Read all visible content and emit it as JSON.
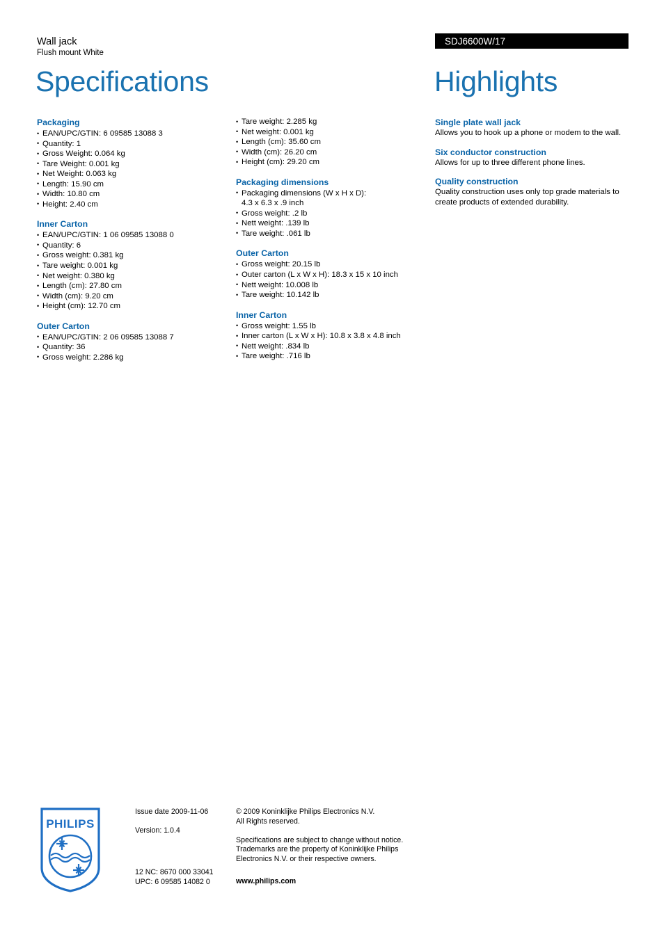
{
  "header": {
    "product_name": "Wall jack",
    "product_subtitle": "Flush mount White",
    "left_title": "Specifications",
    "right_title": "Highlights",
    "product_code": "SDJ6600W/17",
    "accent_color": "#0a64a8",
    "title_color": "#1a72b0",
    "code_bar_bg": "#000000"
  },
  "columns": {
    "col1": [
      {
        "heading": "Packaging",
        "items": [
          "EAN/UPC/GTIN: 6 09585 13088 3",
          "Quantity: 1",
          "Gross Weight: 0.064 kg",
          "Tare Weight: 0.001 kg",
          "Net Weight: 0.063 kg",
          "Length: 15.90 cm",
          "Width: 10.80 cm",
          "Height: 2.40 cm"
        ]
      },
      {
        "heading": "Inner Carton",
        "items": [
          "EAN/UPC/GTIN: 1 06 09585 13088 0",
          "Quantity: 6",
          "Gross weight: 0.381 kg",
          "Tare weight: 0.001 kg",
          "Net weight: 0.380 kg",
          "Length (cm): 27.80 cm",
          "Width (cm): 9.20 cm",
          "Height (cm): 12.70 cm"
        ]
      },
      {
        "heading": "Outer Carton",
        "items": [
          "EAN/UPC/GTIN: 2 06 09585 13088 7",
          "Quantity: 36",
          "Gross weight: 2.286 kg"
        ]
      }
    ],
    "col2": [
      {
        "heading": "",
        "items": [
          "Tare weight: 2.285 kg",
          "Net weight: 0.001 kg",
          "Length (cm): 35.60 cm",
          "Width (cm): 26.20 cm",
          "Height (cm): 29.20 cm"
        ]
      },
      {
        "heading": "Packaging dimensions",
        "items": [
          "Packaging dimensions (W x H x D):",
          "Gross weight: .2 lb",
          "Nett weight: .139 lb",
          "Tare weight: .061 lb"
        ],
        "item_continuations": {
          "0": "4.3 x 6.3 x .9 inch"
        }
      },
      {
        "heading": "Outer Carton",
        "items": [
          "Gross weight: 20.15 lb",
          "Outer carton (L x W x H): 18.3 x 15 x 10 inch",
          "Nett weight: 10.008 lb",
          "Tare weight: 10.142 lb"
        ]
      },
      {
        "heading": "Inner Carton",
        "items": [
          "Gross weight: 1.55 lb",
          "Inner carton (L x W x H): 10.8 x 3.8 x 4.8 inch",
          "Nett weight: .834 lb",
          "Tare weight: .716 lb"
        ]
      }
    ],
    "highlights": [
      {
        "heading": "Single plate wall jack",
        "body": "Allows you to hook up a phone or modem to the wall."
      },
      {
        "heading": "Six conductor construction",
        "body": "Allows for up to three different phone lines."
      },
      {
        "heading": "Quality construction",
        "body": "Quality construction uses only top grade materials to create products of extended durability."
      }
    ]
  },
  "footer": {
    "logo_text": "PHILIPS",
    "issue_date": "Issue date 2009-11-06",
    "version": "Version: 1.0.4",
    "twelve_nc": "12 NC: 8670 000 33041",
    "upc": "UPC: 6 09585 14082 0",
    "copyright_line1": "© 2009 Koninklijke Philips Electronics N.V.",
    "copyright_line2": "All Rights reserved.",
    "disclaimer_line1": "Specifications are subject to change without notice.",
    "disclaimer_line2": "Trademarks are the property of Koninklijke Philips",
    "disclaimer_line3": "Electronics N.V. or their respective owners.",
    "website": "www.philips.com"
  }
}
